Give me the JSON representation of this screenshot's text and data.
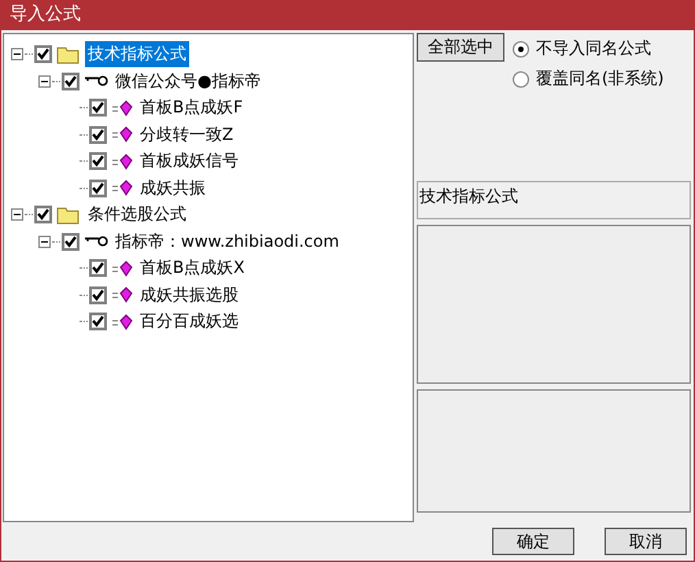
{
  "window": {
    "title": "导入公式"
  },
  "tree": [
    {
      "label": "技术指标公式",
      "kind": "folder",
      "checked": true,
      "expanded": true,
      "selected": true,
      "children": [
        {
          "label": "微信公众号●指标帝",
          "kind": "group",
          "checked": true,
          "expanded": true,
          "selected": false,
          "children": [
            {
              "label": "首板B点成妖F",
              "kind": "formula",
              "checked": true,
              "selected": false
            },
            {
              "label": "分歧转一致Z",
              "kind": "formula",
              "checked": true,
              "selected": false
            },
            {
              "label": "首板成妖信号",
              "kind": "formula",
              "checked": true,
              "selected": false
            },
            {
              "label": "成妖共振",
              "kind": "formula",
              "checked": true,
              "selected": false
            }
          ]
        }
      ]
    },
    {
      "label": "条件选股公式",
      "kind": "folder",
      "checked": true,
      "expanded": true,
      "selected": false,
      "children": [
        {
          "label": "指标帝：www.zhibiaodi.com",
          "kind": "group",
          "checked": true,
          "expanded": true,
          "selected": false,
          "children": [
            {
              "label": "首板B点成妖X",
              "kind": "formula",
              "checked": true,
              "selected": false
            },
            {
              "label": "成妖共振选股",
              "kind": "formula",
              "checked": true,
              "selected": false
            },
            {
              "label": "百分百成妖选",
              "kind": "formula",
              "checked": true,
              "selected": false
            }
          ]
        }
      ]
    }
  ],
  "select_all_button": "全部选中",
  "options": [
    {
      "label": "不导入同名公式",
      "selected": true
    },
    {
      "label": "覆盖同名(非系统)",
      "selected": false
    }
  ],
  "info": "技术指标公式",
  "buttons": [
    "确定",
    "取消"
  ]
}
